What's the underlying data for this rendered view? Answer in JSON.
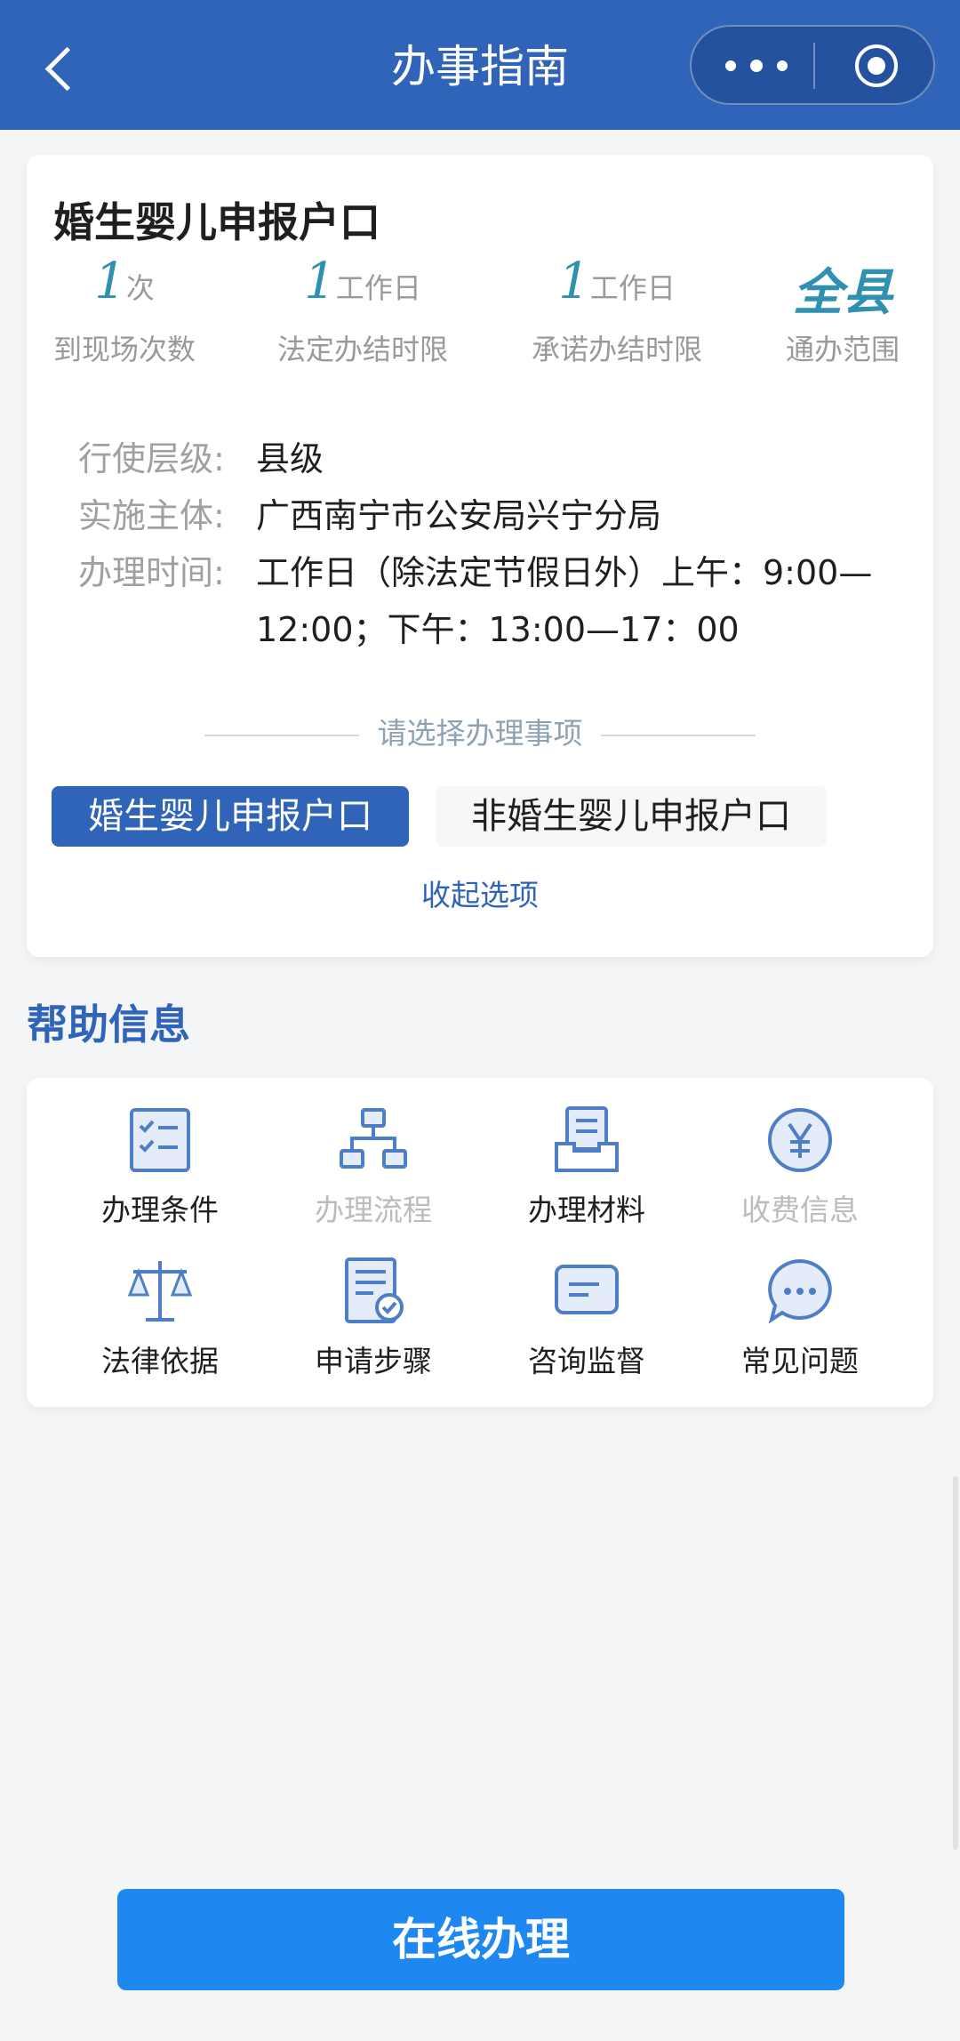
{
  "header": {
    "title": "办事指南"
  },
  "card": {
    "title": "婚生婴儿申报户口",
    "stats": [
      {
        "value": "1",
        "unit": "次",
        "label": "到现场次数"
      },
      {
        "value": "1",
        "unit": "工作日",
        "label": "法定办结时限"
      },
      {
        "value": "1",
        "unit": "工作日",
        "label": "承诺办结时限"
      },
      {
        "value": "全县",
        "unit": "",
        "label": "通办范围"
      }
    ],
    "info": [
      {
        "label": "行使层级:",
        "value": "县级"
      },
      {
        "label": "实施主体:",
        "value": "广西南宁市公安局兴宁分局"
      },
      {
        "label": "办理时间:",
        "value": "工作日（除法定节假日外）上午：9:00—12:00；下午：13:00—17：00"
      }
    ],
    "select_prompt": "请选择办理事项",
    "options": [
      "婚生婴儿申报户口",
      "非婚生婴儿申报户口"
    ],
    "collapse_label": "收起选项"
  },
  "help": {
    "title": "帮助信息",
    "items": [
      {
        "label": "办理条件",
        "icon": "checklist-icon",
        "enabled": true
      },
      {
        "label": "办理流程",
        "icon": "flowchart-icon",
        "enabled": false
      },
      {
        "label": "办理材料",
        "icon": "document-tray-icon",
        "enabled": true
      },
      {
        "label": "收费信息",
        "icon": "yen-icon",
        "enabled": false
      },
      {
        "label": "法律依据",
        "icon": "scales-icon",
        "enabled": true
      },
      {
        "label": "申请步骤",
        "icon": "form-check-icon",
        "enabled": true
      },
      {
        "label": "咨询监督",
        "icon": "message-icon",
        "enabled": true
      },
      {
        "label": "常见问题",
        "icon": "chat-bubble-icon",
        "enabled": true
      }
    ]
  },
  "footer": {
    "button_label": "在线办理"
  },
  "colors": {
    "header": "#2f64b8",
    "accent_number": "#2f90b0",
    "primary_button": "#1e88f0"
  }
}
